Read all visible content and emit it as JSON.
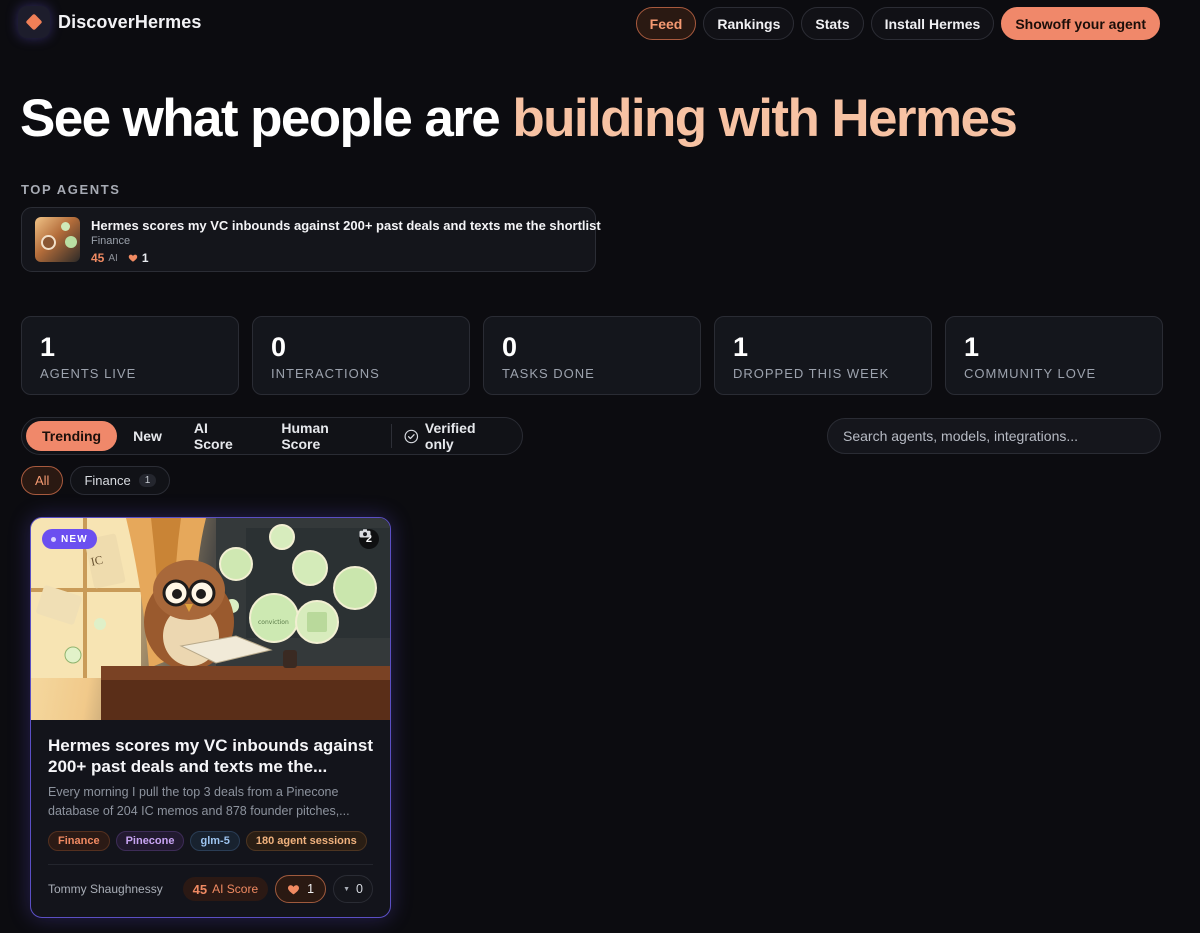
{
  "brand": {
    "name": "DiscoverHermes"
  },
  "nav": {
    "links": [
      {
        "label": "Feed"
      },
      {
        "label": "Rankings"
      },
      {
        "label": "Stats"
      },
      {
        "label": "Install Hermes"
      },
      {
        "label": "Showoff your agent"
      }
    ]
  },
  "hero": {
    "part1": "See what people are ",
    "part2": "building with Hermes"
  },
  "top_agents": {
    "label": "TOP AGENTS",
    "items": [
      {
        "title": "Hermes scores my VC inbounds against 200+ past deals and texts me the shortlist",
        "category": "Finance",
        "score": "45",
        "score_unit": "AI",
        "likes": "1"
      }
    ]
  },
  "stats": [
    {
      "value": "1",
      "label": "AGENTS LIVE"
    },
    {
      "value": "0",
      "label": "INTERACTIONS"
    },
    {
      "value": "0",
      "label": "TASKS DONE"
    },
    {
      "value": "1",
      "label": "DROPPED THIS WEEK"
    },
    {
      "value": "1",
      "label": "COMMUNITY LOVE"
    }
  ],
  "filters": {
    "tabs": [
      {
        "label": "Trending"
      },
      {
        "label": "New"
      },
      {
        "label": "AI Score"
      },
      {
        "label": "Human Score"
      }
    ],
    "verified_label": "Verified only"
  },
  "search": {
    "placeholder": "Search agents, models, integrations..."
  },
  "categories": [
    {
      "label": "All"
    },
    {
      "label": "Finance",
      "count": "1"
    }
  ],
  "cards": [
    {
      "badge": "NEW",
      "media_count": "2",
      "title": "Hermes scores my VC inbounds against 200+ past deals and texts me the...",
      "description": "Every morning I pull the top 3 deals from a Pinecone database of 204 IC memos and 878 founder pitches,...",
      "tags": [
        "Finance",
        "Pinecone",
        "glm-5",
        "180 agent sessions"
      ],
      "author": "Tommy Shaughnessy",
      "score": "45",
      "score_label": "AI Score",
      "likes": "1",
      "comments": "0"
    }
  ],
  "colors": {
    "accent": "#f0886a",
    "accent_text": "#f59a72",
    "hero_highlight": "#f7c2a3",
    "new_badge": "#6b4ff0",
    "background": "#0c0c10"
  }
}
